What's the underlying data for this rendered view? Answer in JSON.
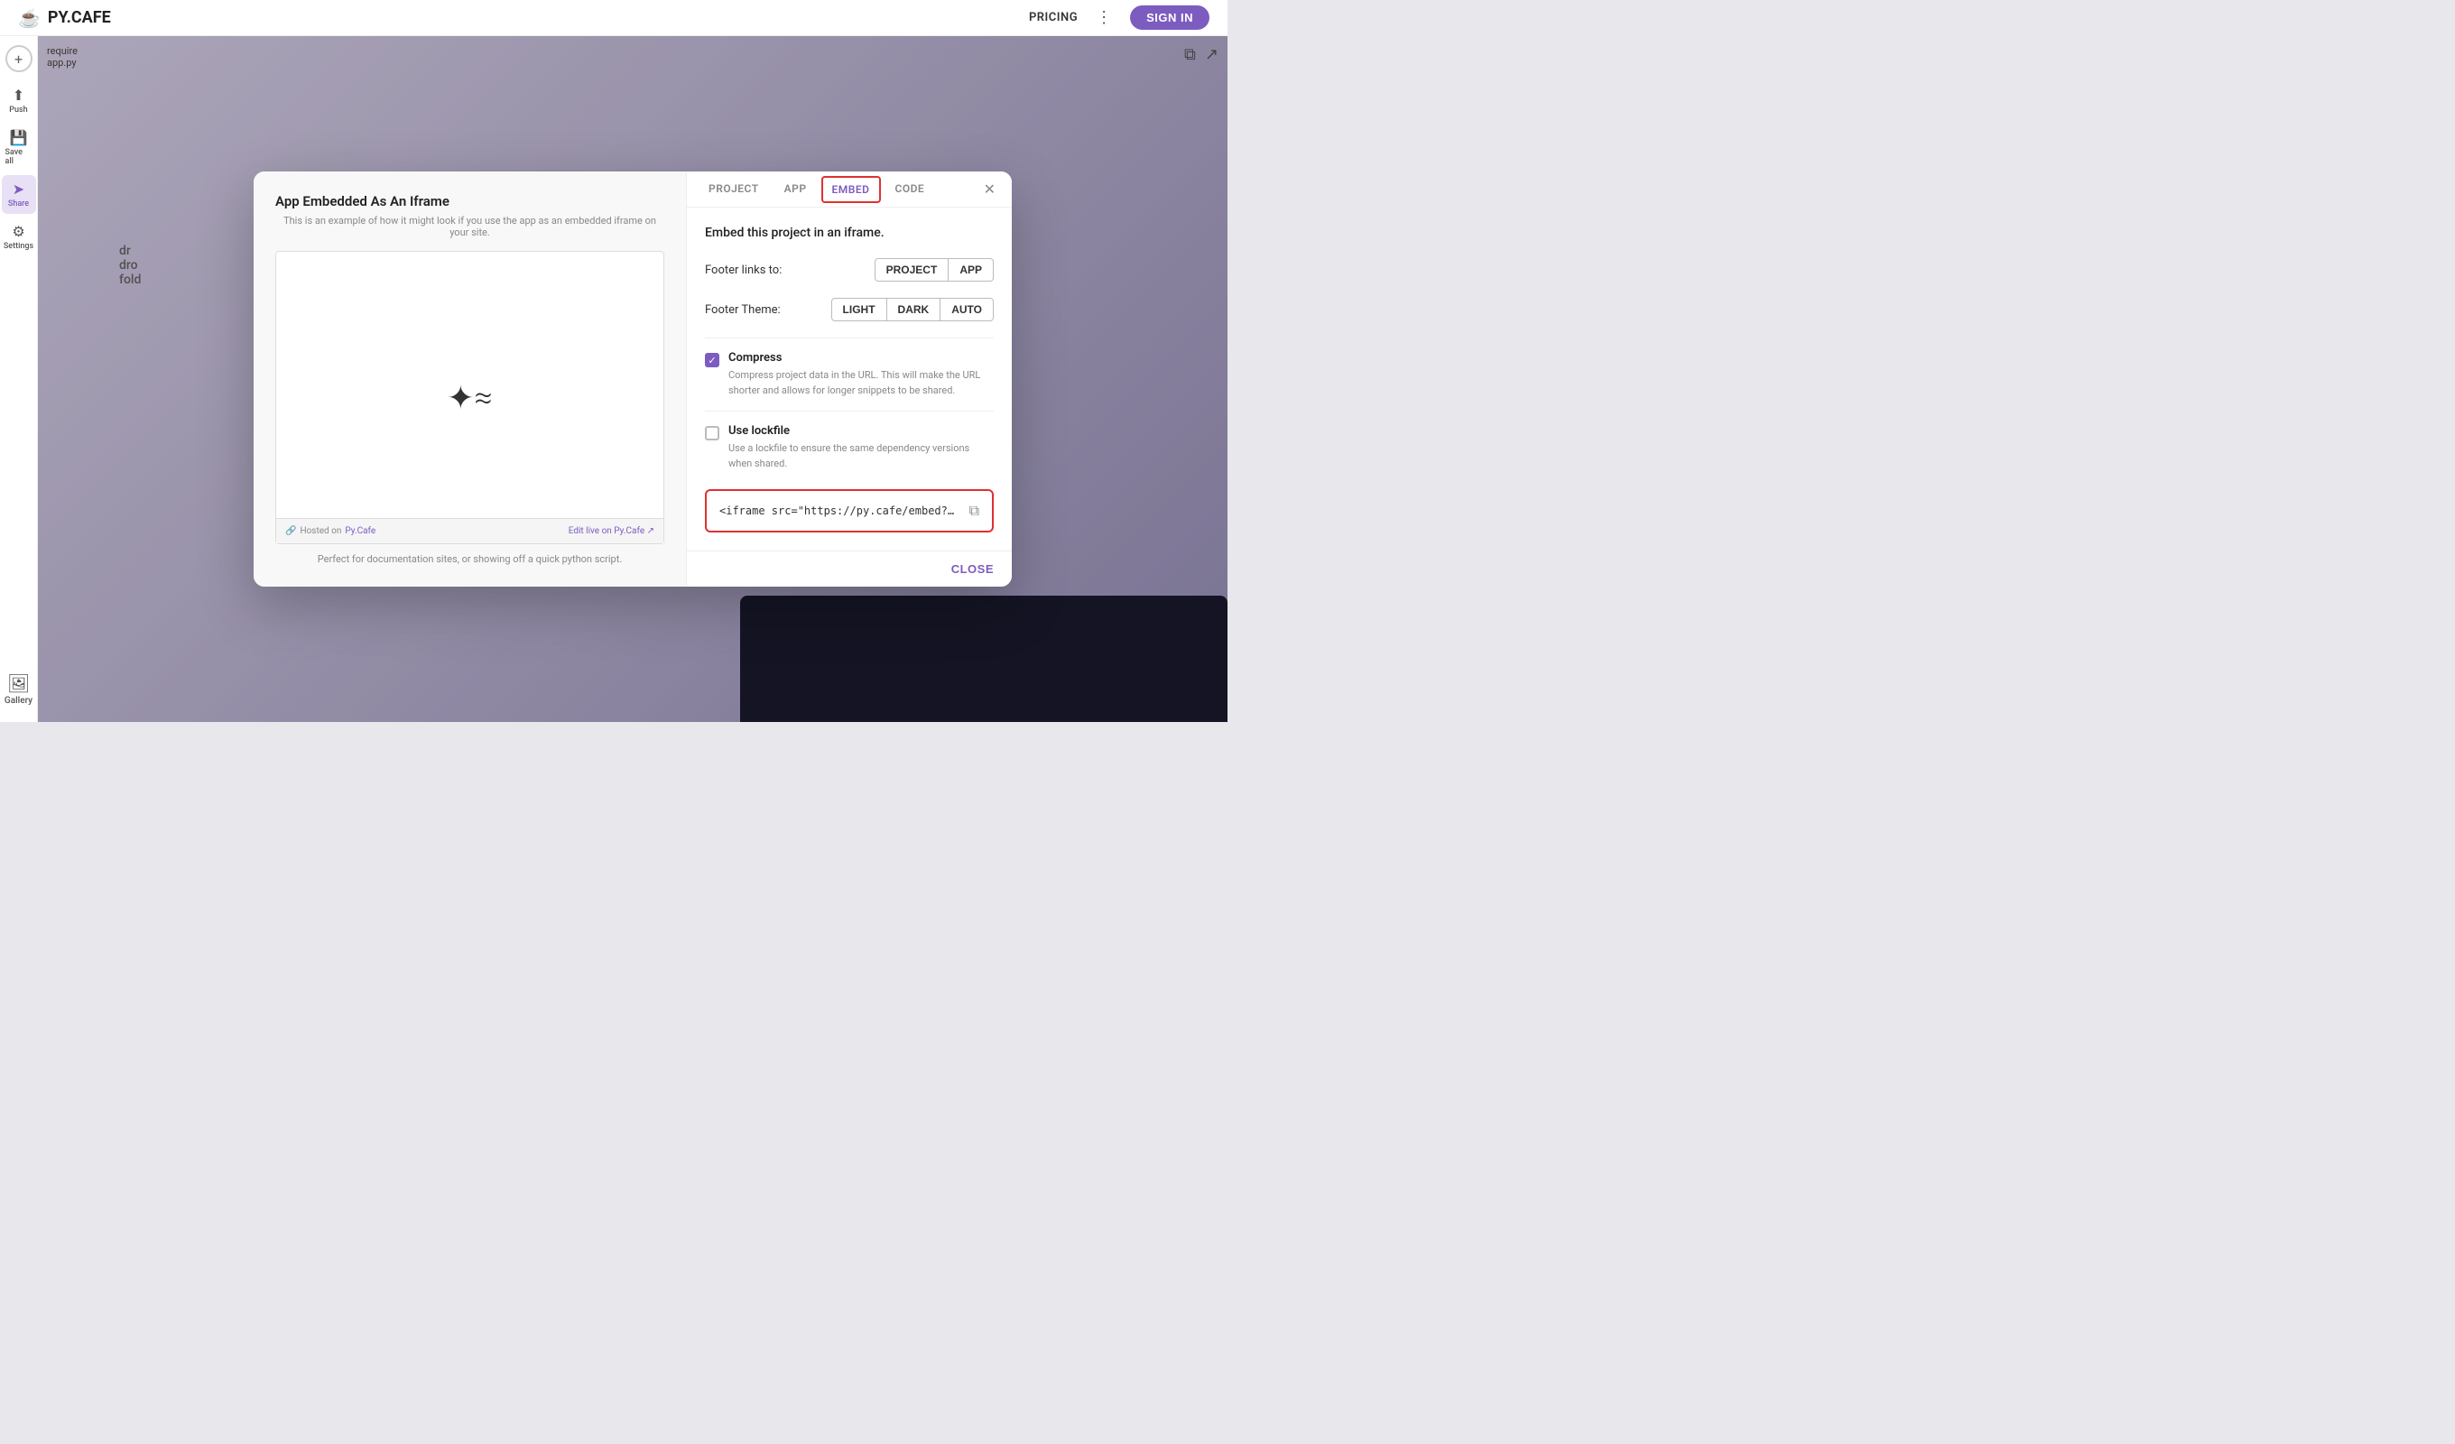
{
  "topbar": {
    "logo": "PY.CAFE",
    "coffee_icon": "☕",
    "pricing_label": "PRICING",
    "dots_label": "⋮",
    "signin_label": "SIGN IN"
  },
  "sidebar": {
    "add_new_label": "+",
    "items": [
      {
        "id": "new",
        "icon": "+",
        "label": ""
      },
      {
        "id": "push",
        "icon": "⬆",
        "label": "Push"
      },
      {
        "id": "save",
        "icon": "💾",
        "label": "Save all"
      },
      {
        "id": "share",
        "icon": "➤",
        "label": "Share",
        "active": true
      },
      {
        "id": "settings",
        "icon": "⚙",
        "label": "Settings"
      }
    ],
    "gallery_label": "Gallery",
    "gallery_icon": "🖼"
  },
  "file_info": {
    "line1": "require",
    "line2": "app.py"
  },
  "drag_drop": {
    "line1": "dr",
    "line2": "dro",
    "line3": "fold"
  },
  "modal": {
    "left": {
      "title": "App Embedded As An Iframe",
      "subtitle": "This is an example of how it might look if you use the app as an embedded iframe on your site.",
      "preview_icon": "✦≈",
      "footer_hosted": "Hosted on",
      "footer_link": "Py.Cafe",
      "footer_edit": "Edit live on Py.Cafe ↗",
      "caption": "Perfect for documentation sites, or showing off a quick python script."
    },
    "right": {
      "tabs": [
        {
          "id": "project",
          "label": "PROJECT",
          "active": false
        },
        {
          "id": "app",
          "label": "APP",
          "active": false
        },
        {
          "id": "embed",
          "label": "EMBED",
          "active": true,
          "highlighted": true
        },
        {
          "id": "code",
          "label": "CODE",
          "active": false
        }
      ],
      "embed_title": "Embed this project in an iframe.",
      "footer_links_label": "Footer links to:",
      "footer_links_options": [
        "PROJECT",
        "APP"
      ],
      "footer_theme_label": "Footer Theme:",
      "footer_theme_options": [
        "LIGHT",
        "DARK",
        "AUTO"
      ],
      "compress": {
        "checked": true,
        "label": "Compress",
        "description": "Compress project data in the URL. This will make the URL shorter and allows for longer snippets to be shared."
      },
      "lockfile": {
        "checked": false,
        "label": "Use lockfile",
        "description": "Use a lockfile to ensure the same dependency versions when shared."
      },
      "embed_code": "<iframe src=\"https://py.cafe/embed?apptype=solara&theme=light&l",
      "close_label": "CLOSE"
    }
  }
}
